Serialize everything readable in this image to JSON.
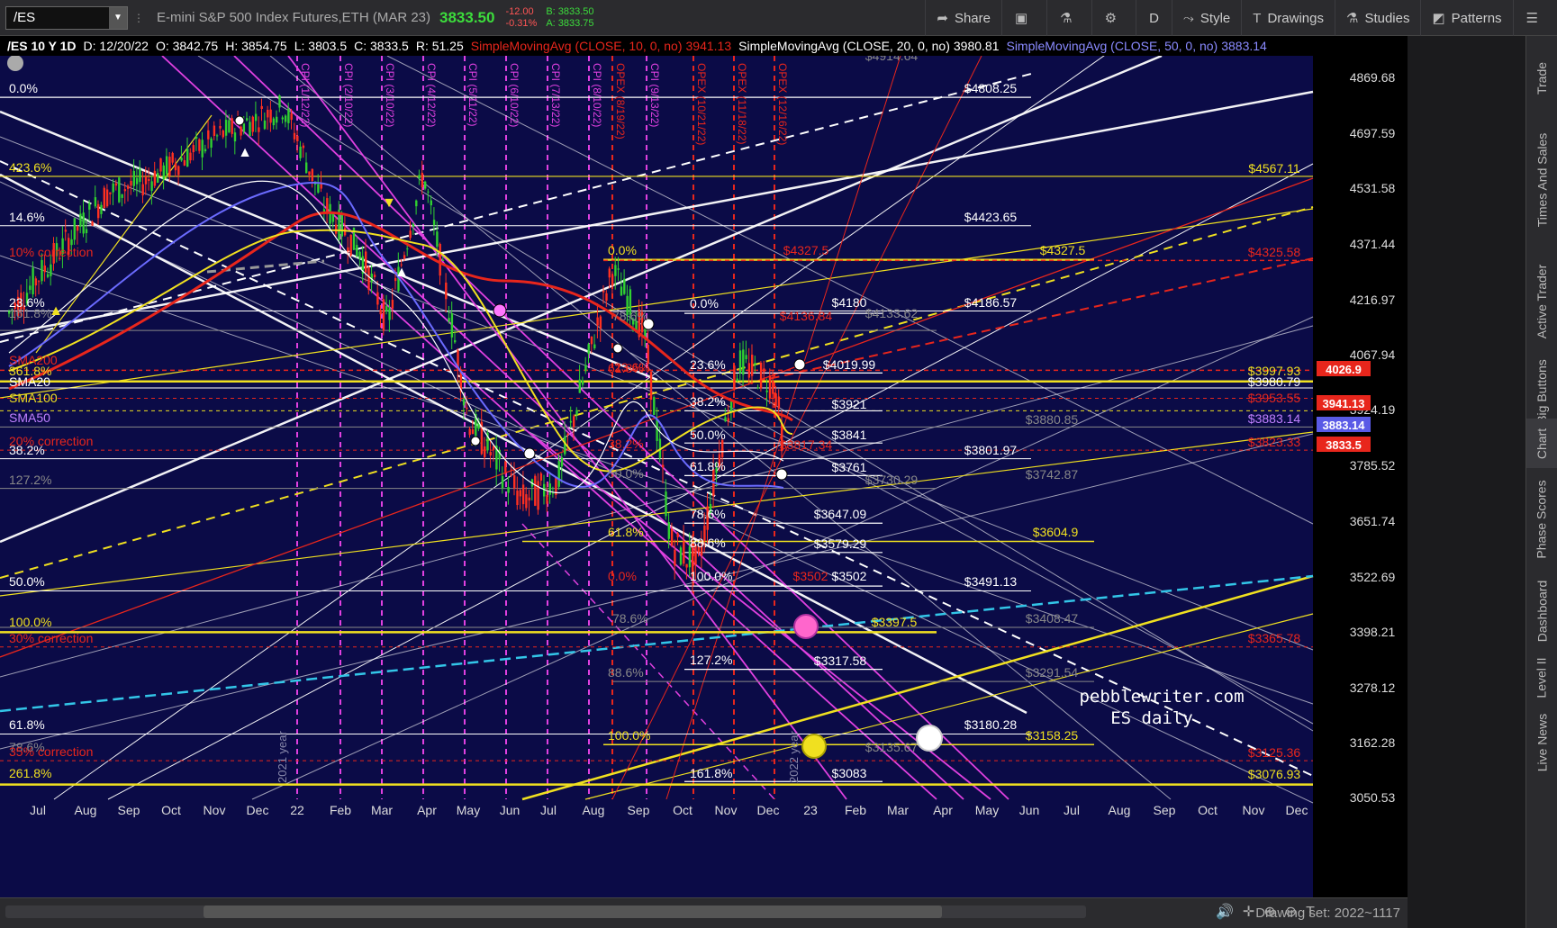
{
  "toolbar": {
    "symbol": "/ES",
    "description": "E-mini S&P 500 Index Futures,ETH (MAR 23)",
    "last": "3833.50",
    "net_change": "-12.00",
    "pct_change": "-0.31%",
    "bid": "B: 3833.50",
    "ask": "A: 3833.75",
    "share": "Share",
    "period": "D",
    "style": "Style",
    "drawings": "Drawings",
    "studies": "Studies",
    "patterns": "Patterns"
  },
  "info": {
    "chart_label": "/ES 10 Y 1D",
    "date": "D: 12/20/22",
    "open": "O: 3842.75",
    "high": "H: 3854.75",
    "low": "L: 3803.5",
    "close": "C: 3833.5",
    "range": "R: 51.25",
    "sma10": "SimpleMovingAvg (CLOSE, 10, 0, no)",
    "sma10_val": "3941.13",
    "sma20": "SimpleMovingAvg (CLOSE, 20, 0, no)",
    "sma20_val": "3980.81",
    "sma50": "SimpleMovingAvg (CLOSE, 50, 0, no)",
    "sma50_val": "3883.14"
  },
  "price_axis": [
    "4869.68",
    "4697.59",
    "4531.58",
    "4371.44",
    "4216.97",
    "4067.94",
    "3924.19",
    "3785.52",
    "3651.74",
    "3522.69",
    "3398.21",
    "3278.12",
    "3162.28",
    "3050.53"
  ],
  "price_badges": [
    {
      "text": "4026.9",
      "color": "#e8261c"
    },
    {
      "text": "3941.13",
      "color": "#e8261c"
    },
    {
      "text": "3883.14",
      "color": "#5a5ae6"
    },
    {
      "text": "3833.5",
      "color": "#e8261c"
    }
  ],
  "time_axis": [
    "Jul",
    "Aug",
    "Sep",
    "Oct",
    "Nov",
    "Dec",
    "22",
    "Feb",
    "Mar",
    "Apr",
    "May",
    "Jun",
    "Jul",
    "Aug",
    "Sep",
    "Oct",
    "Nov",
    "Dec",
    "23",
    "Feb",
    "Mar",
    "Apr",
    "May",
    "Jun",
    "Jul",
    "Aug",
    "Sep",
    "Oct",
    "Nov",
    "Dec"
  ],
  "event_labels": [
    {
      "text": "CPI (1/12/22)",
      "color": "#e040e0"
    },
    {
      "text": "CPI (2/10/22)",
      "color": "#e040e0"
    },
    {
      "text": "CPI (3/10/22)",
      "color": "#e040e0"
    },
    {
      "text": "CPI (4/12/22)",
      "color": "#e040e0"
    },
    {
      "text": "CPI (5/11/22)",
      "color": "#e040e0"
    },
    {
      "text": "CPI (6/10/22)",
      "color": "#e040e0"
    },
    {
      "text": "CPI (7/13/22)",
      "color": "#e040e0"
    },
    {
      "text": "CPI (8/10/22)",
      "color": "#e040e0"
    },
    {
      "text": "OPEX (8/19/22)",
      "color": "#e8261c"
    },
    {
      "text": "CPI (9/13/22)",
      "color": "#e040e0"
    },
    {
      "text": "OPEX (10/21/22)",
      "color": "#e8261c"
    },
    {
      "text": "OPEX (11/18/22)",
      "color": "#e8261c"
    },
    {
      "text": "OPEX (12/16/22)",
      "color": "#e8261c"
    }
  ],
  "levels": [
    {
      "text": "$4808.25",
      "color": "#ffffff"
    },
    {
      "text": "$4567.11",
      "color": "#f0e020"
    },
    {
      "text": "$4423.65",
      "color": "#ffffff"
    },
    {
      "text": "$4327.5",
      "color": "#f0e020"
    },
    {
      "text": "$4325.58",
      "color": "#e8261c"
    },
    {
      "text": "$4186.57",
      "color": "#ffffff"
    },
    {
      "text": "$4180",
      "color": "#ffffff"
    },
    {
      "text": "$4133.62",
      "color": "#888888"
    },
    {
      "text": "$4026.9",
      "color": "#e8261c"
    },
    {
      "text": "$4019.99",
      "color": "#ffffff"
    },
    {
      "text": "$3997.93",
      "color": "#f0e020"
    },
    {
      "text": "$3980.79",
      "color": "#ffffff"
    },
    {
      "text": "$3953.55",
      "color": "#e8261c"
    },
    {
      "text": "$3921",
      "color": "#ffffff"
    },
    {
      "text": "$3880.85",
      "color": "#888888"
    },
    {
      "text": "$3883.14",
      "color": "#c080ff"
    },
    {
      "text": "$3841",
      "color": "#ffffff"
    },
    {
      "text": "$3823.33",
      "color": "#e8261c"
    },
    {
      "text": "$3801.97",
      "color": "#ffffff"
    },
    {
      "text": "$3761",
      "color": "#ffffff"
    },
    {
      "text": "$3742.87",
      "color": "#888888"
    },
    {
      "text": "$3730.29",
      "color": "#888888"
    },
    {
      "text": "$3647.09",
      "color": "#ffffff"
    },
    {
      "text": "$3604.9",
      "color": "#f0e020"
    },
    {
      "text": "$3579.29",
      "color": "#ffffff"
    },
    {
      "text": "$3502",
      "color": "#ffffff"
    },
    {
      "text": "$3491.13",
      "color": "#ffffff"
    },
    {
      "text": "$3408.47",
      "color": "#888888"
    },
    {
      "text": "$3397.5",
      "color": "#f0e020"
    },
    {
      "text": "$3365.78",
      "color": "#e8261c"
    },
    {
      "text": "$3317.58",
      "color": "#ffffff"
    },
    {
      "text": "$3291.54",
      "color": "#888888"
    },
    {
      "text": "$3180.28",
      "color": "#ffffff"
    },
    {
      "text": "$3158.25",
      "color": "#f0e020"
    },
    {
      "text": "$3135.67",
      "color": "#888888"
    },
    {
      "text": "$3125.36",
      "color": "#e8261c"
    },
    {
      "text": "$3083",
      "color": "#ffffff"
    },
    {
      "text": "$3076.93",
      "color": "#f0e020"
    },
    {
      "text": "$4327.5",
      "color": "#e8261c"
    },
    {
      "text": "$4136.84",
      "color": "#e8261c"
    },
    {
      "text": "$3502",
      "color": "#e8261c"
    },
    {
      "text": "$3817.34",
      "color": "#e8261c"
    },
    {
      "text": "$4914.64",
      "color": "#888888"
    }
  ],
  "fib_labels": [
    {
      "text": "0.0%",
      "color": "#ffffff"
    },
    {
      "text": "423.6%",
      "color": "#f0e020"
    },
    {
      "text": "14.6%",
      "color": "#ffffff"
    },
    {
      "text": "10% correction",
      "color": "#e8261c"
    },
    {
      "text": "23.6%",
      "color": "#ffffff"
    },
    {
      "text": "161.8%",
      "color": "#888888"
    },
    {
      "text": "SMA200",
      "color": "#e8261c"
    },
    {
      "text": "361.8%",
      "color": "#f0e020"
    },
    {
      "text": "SMA20",
      "color": "#ffffff"
    },
    {
      "text": "SMA100",
      "color": "#f0e020"
    },
    {
      "text": "SMA50",
      "color": "#c080ff"
    },
    {
      "text": "20% correction",
      "color": "#e8261c"
    },
    {
      "text": "38.2%",
      "color": "#ffffff"
    },
    {
      "text": "127.2%",
      "color": "#888888"
    },
    {
      "text": "50.0%",
      "color": "#ffffff"
    },
    {
      "text": "100.0%",
      "color": "#f0e020"
    },
    {
      "text": "30% correction",
      "color": "#e8261c"
    },
    {
      "text": "61.8%",
      "color": "#ffffff"
    },
    {
      "text": "78.6%",
      "color": "#888888"
    },
    {
      "text": "35% correction",
      "color": "#e8261c"
    },
    {
      "text": "261.8%",
      "color": "#f0e020"
    },
    {
      "text": "0.0%",
      "color": "#f0e020"
    },
    {
      "text": "0.0%",
      "color": "#ffffff"
    },
    {
      "text": "23.6%",
      "color": "#ffffff"
    },
    {
      "text": "38.2%",
      "color": "#ffffff"
    },
    {
      "text": "50.0%",
      "color": "#ffffff"
    },
    {
      "text": "61.8%",
      "color": "#ffffff"
    },
    {
      "text": "78.6%",
      "color": "#ffffff"
    },
    {
      "text": "88.6%",
      "color": "#ffffff"
    },
    {
      "text": "100.0%",
      "color": "#ffffff"
    },
    {
      "text": "127.2%",
      "color": "#ffffff"
    },
    {
      "text": "161.8%",
      "color": "#ffffff"
    },
    {
      "text": "61.8%",
      "color": "#f0e020"
    },
    {
      "text": "100.0%",
      "color": "#f0e020"
    },
    {
      "text": "0.0%",
      "color": "#e8261c"
    },
    {
      "text": "78.6%",
      "color": "#888888"
    },
    {
      "text": "88.6%",
      "color": "#888888"
    },
    {
      "text": "50.0%",
      "color": "#888888"
    },
    {
      "text": "78.6%",
      "color": "#888888"
    },
    {
      "text": "38.2%",
      "color": "#e8261c"
    },
    {
      "text": "61.8%",
      "color": "#e8261c"
    },
    {
      "text": "23.6%",
      "color": "#e8261c"
    }
  ],
  "year_labels": [
    "2021 year",
    "2022 year"
  ],
  "watermark": {
    "line1": "pebblewriter.com",
    "line2": "ES daily"
  },
  "side_tabs": [
    "Trade",
    "Times And Sales",
    "Active Trader",
    "Big Buttons",
    "Chart",
    "Phase Scores",
    "Dashboard",
    "Level II",
    "Live News"
  ],
  "drawing_set": "Drawing set: 2022~1117",
  "colors": {
    "chart_bg": "#0b0b47",
    "accent_green": "#3cdc3c",
    "accent_red": "#e8261c",
    "fib_yellow": "#f0e020",
    "sma50_purple": "#7a7aff",
    "trend_cyan": "#33c6e8",
    "event_magenta": "#e040e0"
  },
  "chart_data": {
    "type": "candlestick",
    "symbol": "/ES",
    "interval": "1D",
    "ylim": [
      3050.53,
      4869.68
    ],
    "last_bar": {
      "date": "12/20/22",
      "open": 3842.75,
      "high": 3854.75,
      "low": 3803.5,
      "close": 3833.5
    },
    "series": [
      {
        "name": "SimpleMovingAvg (CLOSE, 10, 0, no)",
        "last": 3941.13
      },
      {
        "name": "SimpleMovingAvg (CLOSE, 20, 0, no)",
        "last": 3980.81
      },
      {
        "name": "SimpleMovingAvg (CLOSE, 50, 0, no)",
        "last": 3883.14
      }
    ]
  }
}
